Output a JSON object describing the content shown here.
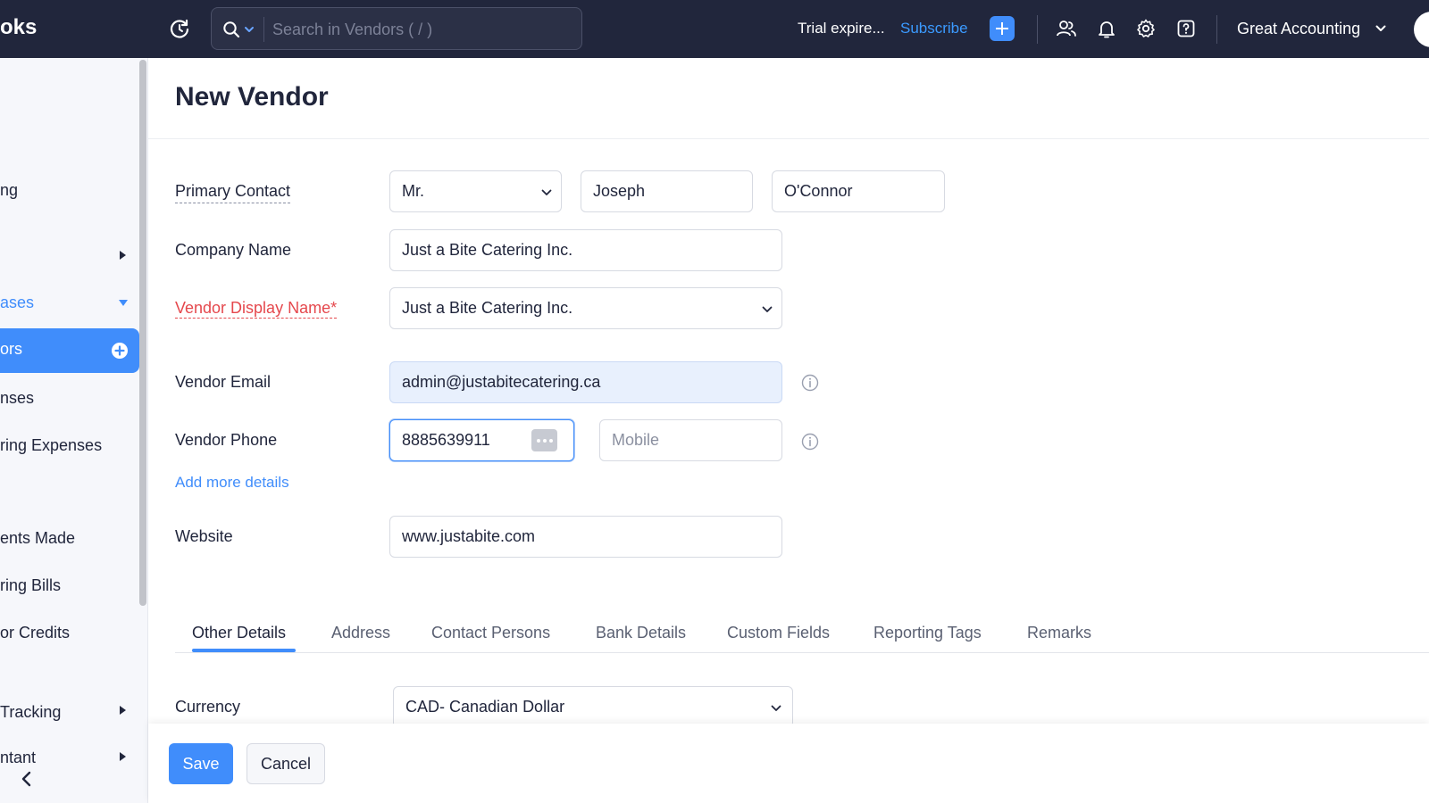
{
  "header": {
    "brand": "oks",
    "search_placeholder": "Search in Vendors ( / )",
    "trial_text": "Trial expire...",
    "subscribe_label": "Subscribe",
    "org_name": "Great Accounting",
    "icons": [
      "recent-activity-icon",
      "search-icon",
      "chevron-down-icon",
      "plus-icon",
      "users-icon",
      "bell-icon",
      "gear-icon",
      "help-icon",
      "avatar"
    ],
    "colors": {
      "bar": "#21263c",
      "accent": "#408dfb"
    }
  },
  "sidebar": {
    "items": [
      {
        "label": "ng"
      },
      {
        "label": ""
      },
      {
        "label": "ases"
      },
      {
        "label": "ors"
      },
      {
        "label": "nses"
      },
      {
        "label": "ring Expenses"
      },
      {
        "label": "ents Made"
      },
      {
        "label": "ring Bills"
      },
      {
        "label": "or Credits"
      },
      {
        "label": "Tracking"
      },
      {
        "label": "ntant"
      }
    ]
  },
  "page": {
    "title": "New Vendor"
  },
  "form": {
    "primary_contact_label": "Primary Contact",
    "salutation_value": "Mr.",
    "first_name_value": "Joseph",
    "last_name_value": "O'Connor",
    "company_name_label": "Company Name",
    "company_name_value": "Just a Bite Catering Inc.",
    "display_name_label": "Vendor Display Name*",
    "display_name_value": "Just a Bite Catering Inc.",
    "email_label": "Vendor Email",
    "email_value": "admin@justabitecatering.ca",
    "phone_label": "Vendor Phone",
    "work_phone_value": "8885639911",
    "mobile_placeholder": "Mobile",
    "add_more_label": "Add more details",
    "website_label": "Website",
    "website_value": "www.justabite.com",
    "currency_label": "Currency",
    "currency_value": "CAD- Canadian Dollar"
  },
  "tabs": [
    {
      "label": "Other Details",
      "active": true
    },
    {
      "label": "Address"
    },
    {
      "label": "Contact Persons"
    },
    {
      "label": "Bank Details"
    },
    {
      "label": "Custom Fields"
    },
    {
      "label": "Reporting Tags"
    },
    {
      "label": "Remarks"
    }
  ],
  "footer": {
    "save_label": "Save",
    "cancel_label": "Cancel"
  }
}
